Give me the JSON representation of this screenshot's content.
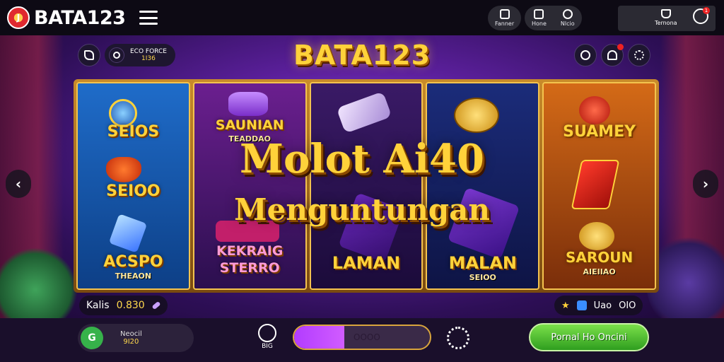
{
  "brand": {
    "logo_mark": "J",
    "name": "BATA123"
  },
  "topbar": {
    "actions_a": [
      {
        "label": "Fanner",
        "icon": "shield-icon"
      }
    ],
    "actions_b": [
      {
        "label": "Hone",
        "icon": "home-icon"
      },
      {
        "label": "Nlcio",
        "icon": "chat-icon"
      }
    ],
    "account": {
      "label": "Ternona",
      "icon": "user-icon",
      "notif_count": "1"
    }
  },
  "game": {
    "title": "BATA123",
    "jackpot_line1": "ECO FORCE",
    "jackpot_line2": "1I36",
    "headline_line1": "Molot Ai40",
    "headline_line2": "Menguntungan",
    "reels": [
      {
        "top": "SEIOS",
        "mid": "SEIOO",
        "bottom": "ACSPO",
        "bottom_sub": "THEAON"
      },
      {
        "top": "SAUNIAN",
        "top_sub": "TEADDAO",
        "bottom": "KEKRAIG",
        "bottom_sub": "STERRO"
      },
      {
        "bottom": "LAMAN"
      },
      {
        "bottom": "MALAN",
        "bottom_sub": "SEIOO"
      },
      {
        "top": "SUAMEY",
        "bottom": "SAROUN",
        "bottom_sub": "AIEIIAO"
      }
    ],
    "left_stat": {
      "label": "Kalis",
      "value": "0.830"
    },
    "right_stat": {
      "label": "Uao",
      "value": "OIO"
    }
  },
  "bottombar": {
    "balance_label": "Neocil",
    "balance_value": "9I20",
    "balance_icon": "G",
    "bet_label": "BIG",
    "progress_text": "OOOO",
    "progress_fraction": 0.37,
    "play_label": "Pornal Ho Oncini"
  },
  "colors": {
    "accent_gold": "#ffd23a",
    "play_green": "#3fbf2a",
    "progress_purple": "#c24cff"
  }
}
